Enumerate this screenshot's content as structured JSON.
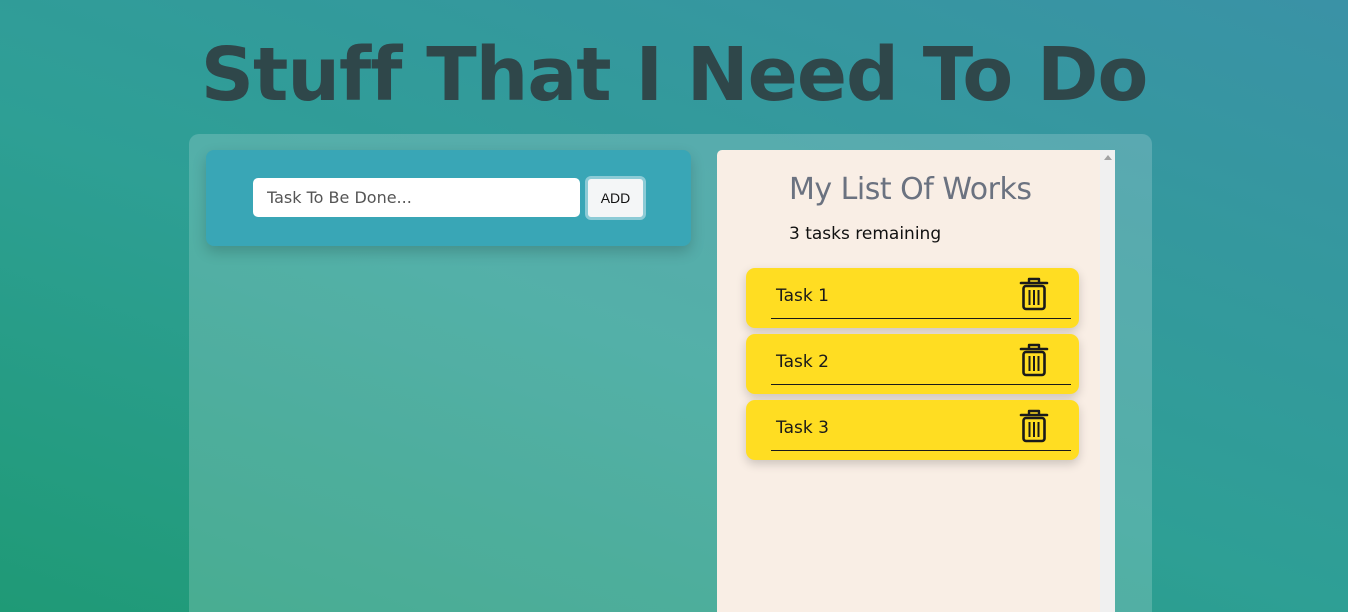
{
  "page": {
    "title": "Stuff That I Need To Do"
  },
  "add_form": {
    "placeholder": "Task To Be Done...",
    "value": "",
    "add_label": "ADD"
  },
  "list": {
    "title": "My List Of Works",
    "remaining": "3 tasks remaining",
    "tasks": [
      {
        "label": "Task 1",
        "icon": "trash-icon"
      },
      {
        "label": "Task 2",
        "icon": "trash-icon"
      },
      {
        "label": "Task 3",
        "icon": "trash-icon"
      }
    ]
  },
  "colors": {
    "task_bg": "#ffdd22",
    "add_card_bg": "#39a6b6",
    "list_bg": "#f9eee5",
    "title_color": "#2f474a"
  }
}
